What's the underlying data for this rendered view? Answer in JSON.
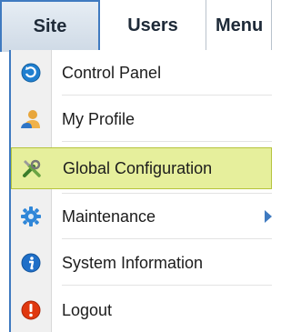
{
  "menubar": {
    "tabs": [
      {
        "label": "Site"
      },
      {
        "label": "Users"
      },
      {
        "label": "Menu"
      }
    ]
  },
  "site_menu": {
    "items": [
      {
        "label": "Control Panel",
        "icon": "control-panel-icon"
      },
      {
        "label": "My Profile",
        "icon": "user-profile-icon"
      },
      {
        "label": "Global Configuration",
        "icon": "tools-icon",
        "highlighted": true
      },
      {
        "label": "Maintenance",
        "icon": "gear-icon",
        "has_submenu": true
      },
      {
        "label": "System Information",
        "icon": "info-icon"
      },
      {
        "label": "Logout",
        "icon": "logout-icon"
      }
    ]
  },
  "colors": {
    "accent_blue": "#3f7ac0",
    "highlight_bg": "#e6ef9c",
    "highlight_border": "#b6c43d"
  }
}
